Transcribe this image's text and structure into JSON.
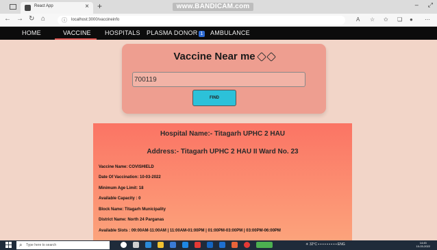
{
  "browser": {
    "tab_title": "React App",
    "watermark": "www.BANDICAM.com",
    "url": "localhost:3000/vaccineinfo"
  },
  "navbar": {
    "items": [
      "HOME",
      "VACCINE",
      "HOSPITALS",
      "PLASMA DONOR",
      "AMBULANCE"
    ],
    "badge": "1",
    "active": "VACCINE",
    "accent": "#d9534f"
  },
  "search": {
    "title": "Vaccine Near me",
    "pincode": "700119",
    "find_label": "FIND"
  },
  "result": {
    "hospital_name": "Hospital Name:- Titagarh UPHC 2 HAU",
    "address": "Address:- Titagarh UPHC 2 HAU II Ward No. 23",
    "vaccine_name": "Vaccine Name: COVISHIELD",
    "date": "Date Of Vaccination: 10-03-2022",
    "min_age": "Minimum Age Limit: 18",
    "capacity": "Available Capacity : 0",
    "block": "Block Name: Titagarh Municipality",
    "district": "District Name: North 24 Parganas",
    "slots": "Available Slots : 09:00AM-11:00AM | 11:00AM-01:00PM | 01:00PM-03:00PM | 03:00PM-06:00PM"
  },
  "taskbar": {
    "search_placeholder": "Type here to search",
    "temperature": "32°C",
    "lang": "ENG",
    "time": "14:45",
    "date": "10-03-2022"
  },
  "colors": {
    "page_bg": "#f2d5c8",
    "card_bg": "#ee9e90",
    "button": "#2cc1d9",
    "result_top": "#fb7464",
    "result_bottom": "#fca47c"
  }
}
